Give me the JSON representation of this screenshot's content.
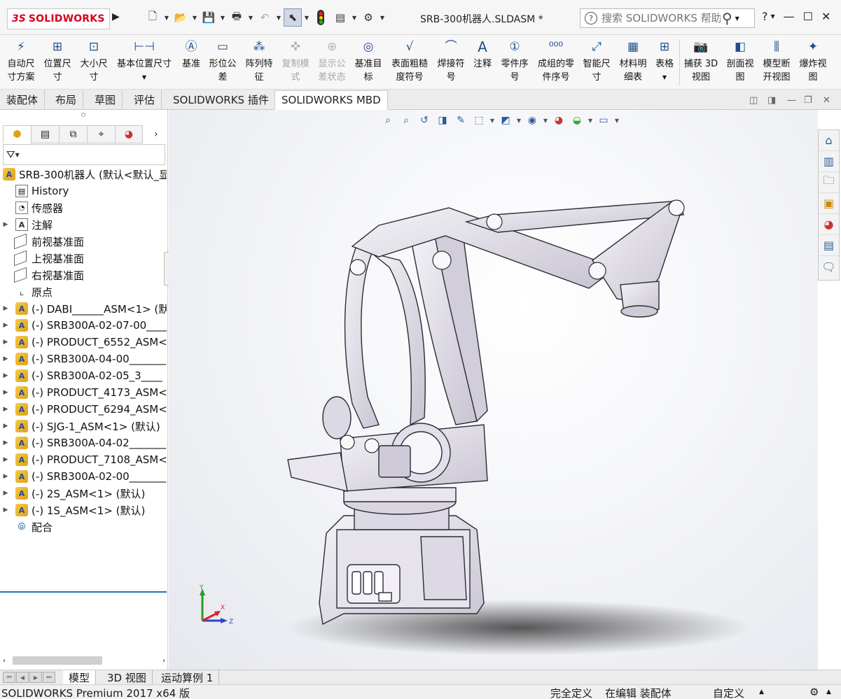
{
  "app": {
    "logo_ds": "3S",
    "logo_text": "SOLIDWORKS",
    "document_title": "SRB-300机器人.SLDASM *"
  },
  "search": {
    "placeholder": "搜索 SOLIDWORKS 帮助"
  },
  "help_menu": "?",
  "ribbon": [
    {
      "label": "自动尺\n寸方案",
      "icon": "auto-dimension-icon",
      "enabled": true
    },
    {
      "label": "位置尺\n寸",
      "icon": "location-dimension-icon",
      "enabled": true
    },
    {
      "label": "大小尺\n寸",
      "icon": "size-dimension-icon",
      "enabled": true
    },
    {
      "label": "基本位置尺寸",
      "icon": "basic-location-dimension-icon",
      "enabled": true
    },
    {
      "label": "基准",
      "icon": "datum-icon",
      "enabled": true
    },
    {
      "label": "形位公\n差",
      "icon": "geometric-tolerance-icon",
      "enabled": true
    },
    {
      "label": "阵列特\n征",
      "icon": "pattern-feature-icon",
      "enabled": true
    },
    {
      "label": "复制模\n式",
      "icon": "copy-scheme-icon",
      "enabled": false
    },
    {
      "label": "显示公\n差状态",
      "icon": "show-tolerance-status-icon",
      "enabled": false
    },
    {
      "label": "基准目\n标",
      "icon": "datum-target-icon",
      "enabled": true
    },
    {
      "label": "表面粗糙\n度符号",
      "icon": "surface-finish-icon",
      "enabled": true
    },
    {
      "label": "焊接符\n号",
      "icon": "weld-symbol-icon",
      "enabled": true
    },
    {
      "label": "注释",
      "icon": "note-icon",
      "enabled": true
    },
    {
      "label": "零件序\n号",
      "icon": "balloon-icon",
      "enabled": true
    },
    {
      "label": "成组的零\n件序号",
      "icon": "stacked-balloon-icon",
      "enabled": true
    },
    {
      "label": "智能尺\n寸",
      "icon": "smart-dimension-icon",
      "enabled": true
    },
    {
      "label": "材料明\n细表",
      "icon": "bom-icon",
      "enabled": true
    },
    {
      "label": "表格",
      "icon": "table-icon",
      "enabled": true
    },
    {
      "label": "捕获 3D\n视图",
      "icon": "capture-3d-view-icon",
      "enabled": true
    },
    {
      "label": "剖面视\n图",
      "icon": "section-view-icon",
      "enabled": true
    },
    {
      "label": "模型断\n开视图",
      "icon": "break-view-icon",
      "enabled": true
    },
    {
      "label": "爆炸视\n图",
      "icon": "explode-view-icon",
      "enabled": true
    }
  ],
  "tabs": [
    "装配体",
    "布局",
    "草图",
    "评估",
    "SOLIDWORKS 插件",
    "SOLIDWORKS MBD"
  ],
  "active_tab": "SOLIDWORKS MBD",
  "feature_tree": {
    "root": "SRB-300机器人 (默认<默认_显",
    "items": [
      {
        "label": "History",
        "icon": "history-icon",
        "expandable": false
      },
      {
        "label": "传感器",
        "icon": "sensor-icon",
        "expandable": false
      },
      {
        "label": "注解",
        "icon": "annotation-icon",
        "expandable": true
      },
      {
        "label": "前视基准面",
        "icon": "plane-icon",
        "expandable": false
      },
      {
        "label": "上视基准面",
        "icon": "plane-icon",
        "expandable": false
      },
      {
        "label": "右视基准面",
        "icon": "plane-icon",
        "expandable": false
      },
      {
        "label": "原点",
        "icon": "origin-icon",
        "expandable": false
      },
      {
        "label": "(-) DABI______ASM<1> (默",
        "icon": "assembly-icon",
        "expandable": true
      },
      {
        "label": "(-) SRB300A-02-07-00____",
        "icon": "assembly-icon",
        "expandable": true
      },
      {
        "label": "(-) PRODUCT_6552_ASM<",
        "icon": "assembly-icon",
        "expandable": true
      },
      {
        "label": "(-) SRB300A-04-00_______",
        "icon": "assembly-icon",
        "expandable": true
      },
      {
        "label": "(-) SRB300A-02-05_3____",
        "icon": "assembly-icon",
        "expandable": true
      },
      {
        "label": "(-) PRODUCT_4173_ASM<",
        "icon": "assembly-icon",
        "expandable": true
      },
      {
        "label": "(-) PRODUCT_6294_ASM<",
        "icon": "assembly-icon",
        "expandable": true
      },
      {
        "label": "(-) SJG-1_ASM<1> (默认)",
        "icon": "assembly-icon",
        "expandable": true
      },
      {
        "label": "(-) SRB300A-04-02_______",
        "icon": "assembly-icon",
        "expandable": true
      },
      {
        "label": "(-) PRODUCT_7108_ASM<",
        "icon": "assembly-icon",
        "expandable": true
      },
      {
        "label": "(-) SRB300A-02-00_______",
        "icon": "assembly-icon",
        "expandable": true
      },
      {
        "label": "(-) 2S_ASM<1> (默认)",
        "icon": "assembly-icon",
        "expandable": true
      },
      {
        "label": "(-) 1S_ASM<1> (默认)",
        "icon": "assembly-icon",
        "expandable": true
      },
      {
        "label": "配合",
        "icon": "mates-icon",
        "expandable": false
      }
    ]
  },
  "triad": {
    "x": "X",
    "y": "Y",
    "z": "Z"
  },
  "bottom_tabs": [
    "模型",
    "3D 视图",
    "运动算例 1"
  ],
  "status": {
    "product": "SOLIDWORKS Premium 2017 x64 版",
    "definition": "完全定义",
    "editing": "在编辑 装配体",
    "units": "自定义"
  },
  "colors": {
    "brand_red": "#d6001c",
    "icon_blue": "#1f4e8c",
    "selection_line": "#2a6bc2"
  }
}
